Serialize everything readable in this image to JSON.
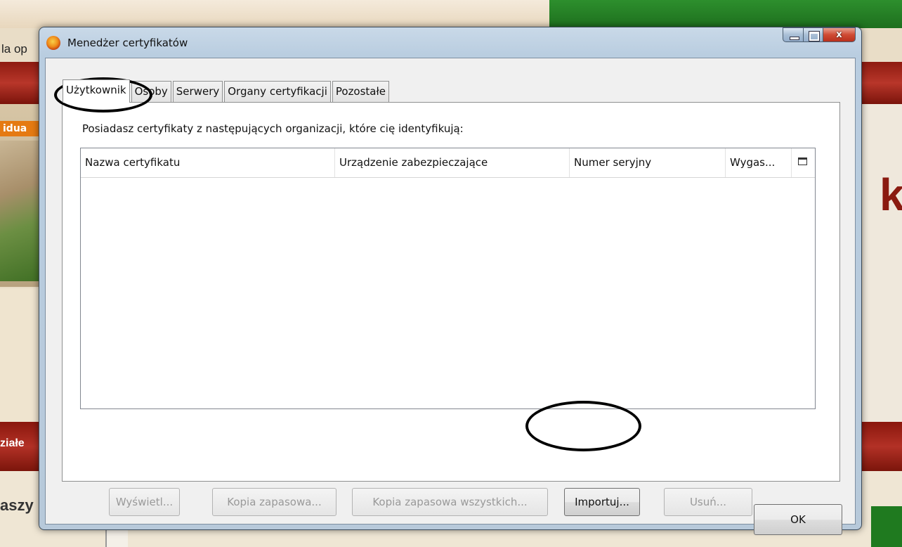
{
  "background": {
    "left_text": "la op",
    "side_label": "idua",
    "right_text": "ka",
    "left_section": "ziałe",
    "bottom_left_text": "aszy"
  },
  "window": {
    "title": "Menedżer certyfikatów",
    "controls": {
      "minimize": "–",
      "maximize": "□",
      "close": "x"
    }
  },
  "tabs": [
    {
      "label": "Użytkownik",
      "active": true
    },
    {
      "label": "Osoby",
      "active": false
    },
    {
      "label": "Serwery",
      "active": false
    },
    {
      "label": "Organy certyfikacji",
      "active": false
    },
    {
      "label": "Pozostałe",
      "active": false
    }
  ],
  "panel": {
    "description": "Posiadasz certyfikaty z następujących organizacji, które cię identyfikują:",
    "columns": [
      "Nazwa certyfikatu",
      "Urządzenie zabezpieczające",
      "Numer seryjny",
      "Wygas..."
    ],
    "rows": []
  },
  "buttons": {
    "view": {
      "label": "Wyświetl...",
      "enabled": false
    },
    "backup": {
      "label": "Kopia zapasowa...",
      "enabled": false
    },
    "backup_all": {
      "label": "Kopia zapasowa wszystkich...",
      "enabled": false
    },
    "import": {
      "label": "Importuj...",
      "enabled": true
    },
    "delete": {
      "label": "Usuń...",
      "enabled": false
    },
    "ok": {
      "label": "OK",
      "enabled": true
    }
  },
  "icons": {
    "app": "firefox-icon",
    "column_picker": "column-picker-icon"
  },
  "annotations": [
    "ellipse around Użytkownik tab",
    "ellipse around Importuj button"
  ]
}
